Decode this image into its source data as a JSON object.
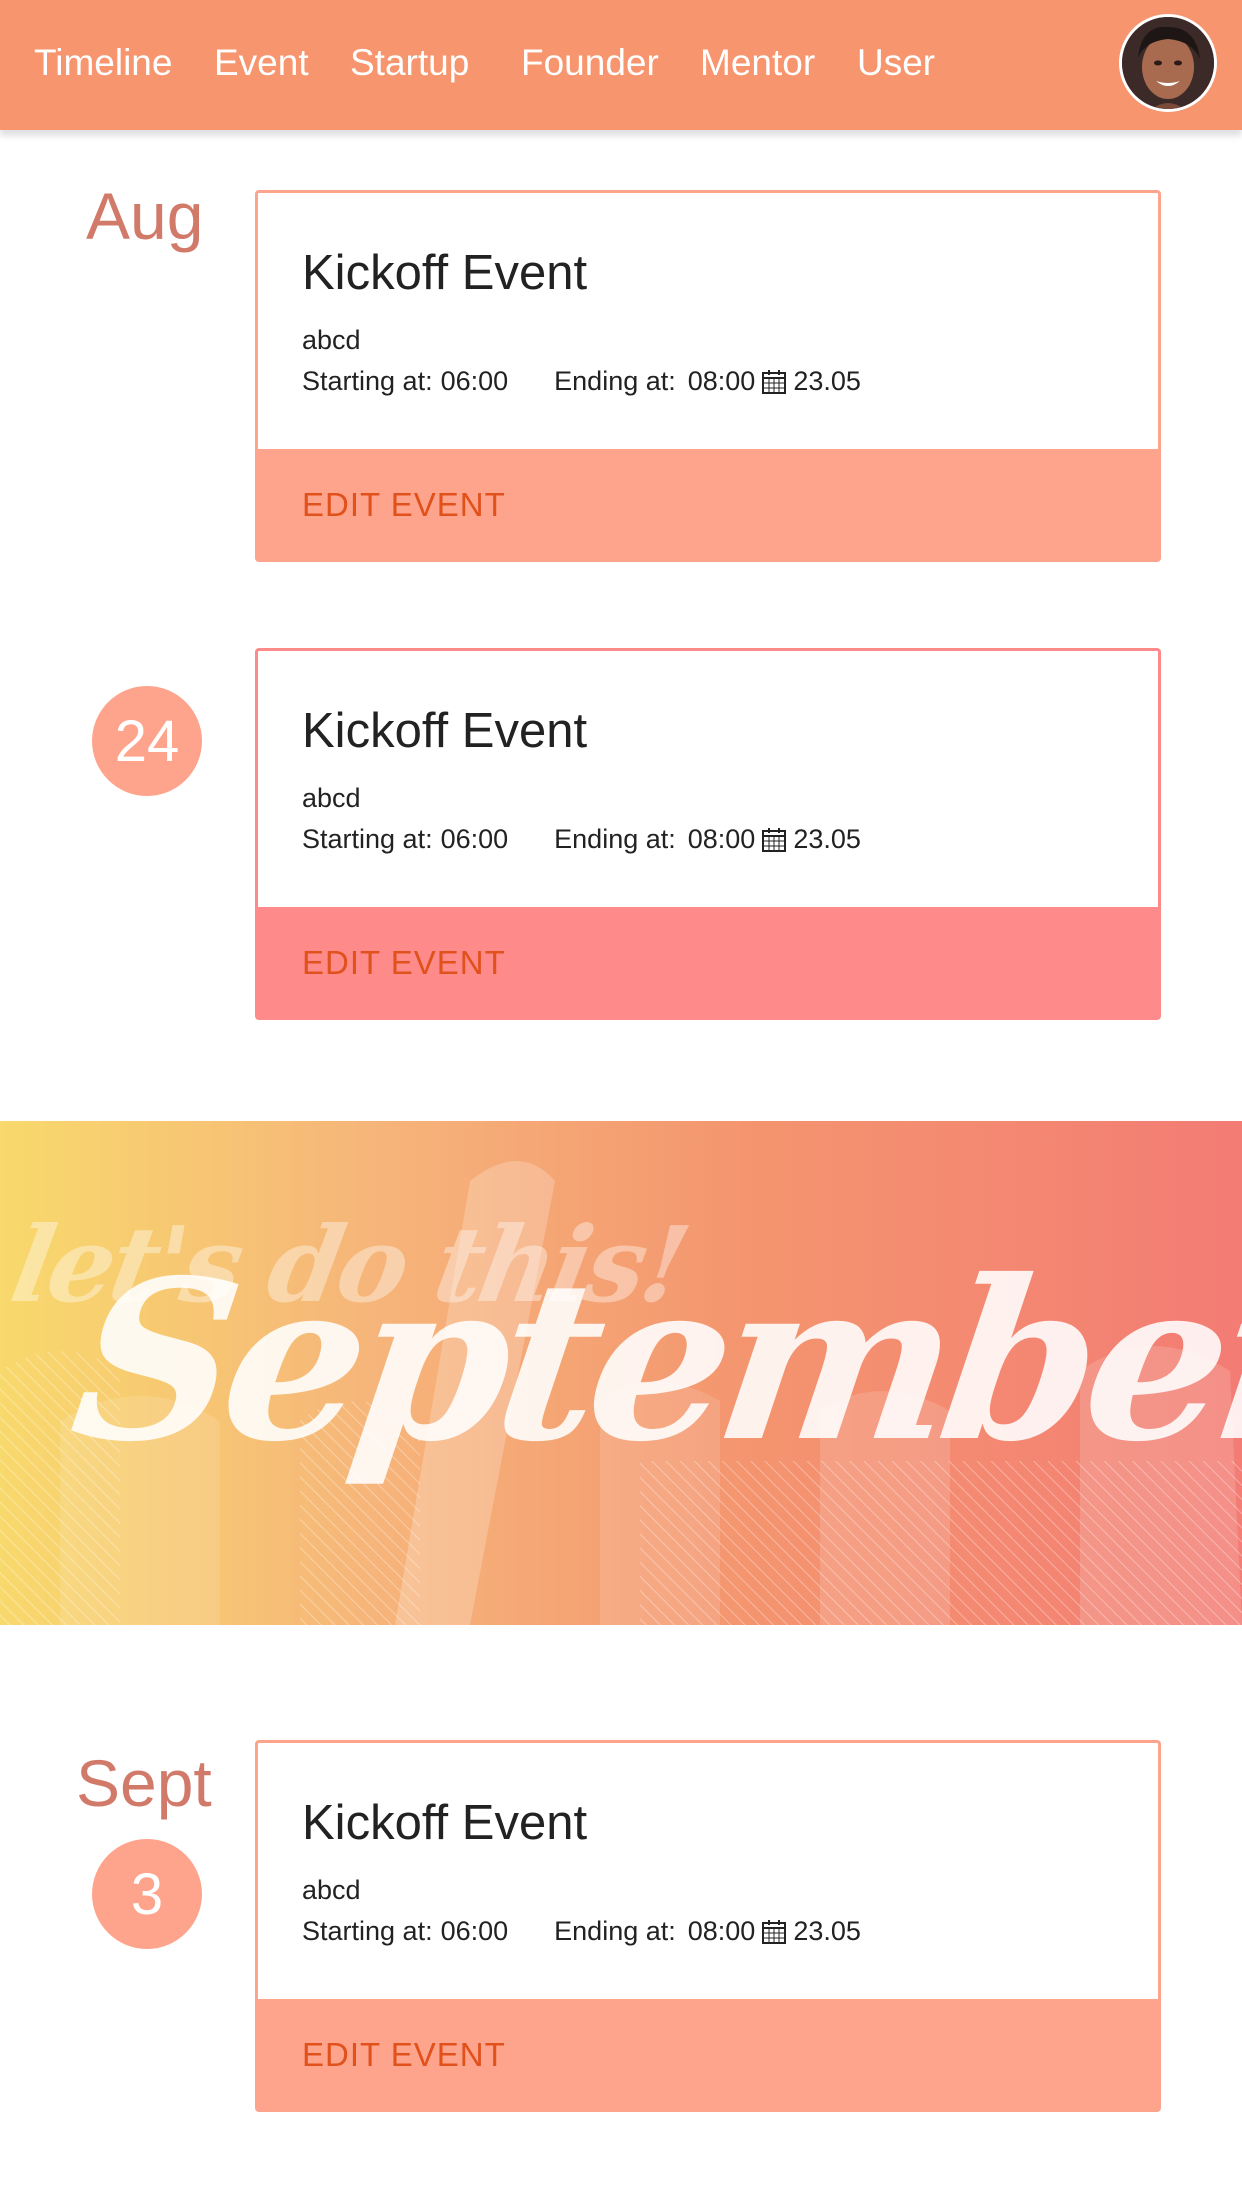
{
  "nav": {
    "items": [
      "Timeline",
      "Event",
      "Startup",
      "Founder",
      "Mentor",
      "User"
    ]
  },
  "colors": {
    "nav_bg": "#f6956e",
    "accent_salmon": "#ffa48c",
    "accent_pink": "#ff8a8a",
    "button_text": "#e0511c",
    "month_text": "#d27a6a"
  },
  "timeline": {
    "aug": {
      "month": "Aug",
      "day": "24"
    },
    "sept": {
      "month": "Sept",
      "day": "3"
    }
  },
  "events": [
    {
      "title": "Kickoff Event",
      "description": "abcd",
      "start_label": "Starting at:",
      "start_time": "06:00",
      "end_label": "Ending at:",
      "end_time": "08:00",
      "date": "23.05",
      "button": "EDIT EVENT",
      "footer_color": "#ffa48c"
    },
    {
      "title": "Kickoff Event",
      "description": "abcd",
      "start_label": "Starting at:",
      "start_time": "06:00",
      "end_label": "Ending at:",
      "end_time": "08:00",
      "date": "23.05",
      "button": "EDIT EVENT",
      "footer_color": "#ff8a8a"
    },
    {
      "title": "Kickoff Event",
      "description": "abcd",
      "start_label": "Starting at:",
      "start_time": "06:00",
      "end_label": "Ending at:",
      "end_time": "08:00",
      "date": "23.05",
      "button": "EDIT EVENT",
      "footer_color": "#ffa48c"
    }
  ],
  "banner": {
    "tagline": "let's do this!",
    "title": "September"
  }
}
